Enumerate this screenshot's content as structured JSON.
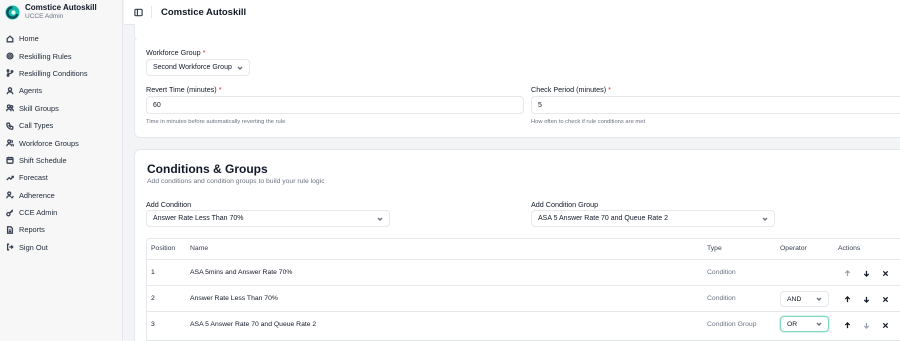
{
  "app": {
    "name": "Comstice Autoskill",
    "subtitle": "UCCE Admin"
  },
  "sidebar": {
    "items": [
      {
        "label": "Home",
        "icon": "home-icon"
      },
      {
        "label": "Reskilling Rules",
        "icon": "gear-icon"
      },
      {
        "label": "Reskilling Conditions",
        "icon": "branch-icon"
      },
      {
        "label": "Agents",
        "icon": "user-icon"
      },
      {
        "label": "Skill Groups",
        "icon": "users-icon"
      },
      {
        "label": "Call Types",
        "icon": "phone-icon"
      },
      {
        "label": "Workforce Groups",
        "icon": "user-group-icon"
      },
      {
        "label": "Shift Schedule",
        "icon": "calendar-icon"
      },
      {
        "label": "Forecast",
        "icon": "trend-icon"
      },
      {
        "label": "Adherence",
        "icon": "user-check-icon"
      },
      {
        "label": "CCE Admin",
        "icon": "key-icon"
      },
      {
        "label": "Reports",
        "icon": "file-icon"
      },
      {
        "label": "Sign Out",
        "icon": "logout-icon"
      }
    ]
  },
  "header": {
    "title": "Comstice Autoskill"
  },
  "form": {
    "workforce_group_label": "Workforce Group",
    "workforce_group_value": "Second Workforce Group",
    "revert_time_label": "Revert Time (minutes)",
    "revert_time_value": "60",
    "revert_time_help": "Time in minutes before automatically reverting the rule",
    "check_period_label": "Check Period (minutes)",
    "check_period_value": "5",
    "check_period_help": "How often to check if rule conditions are met",
    "required_mark": "*"
  },
  "conditions": {
    "title": "Conditions & Groups",
    "subtitle": "Add conditions and condition groups to build your rule logic",
    "add_condition_label": "Add Condition",
    "add_condition_value": "Answer Rate Less Than 70%",
    "add_group_label": "Add Condition Group",
    "add_group_value": "ASA 5 Answer Rate 70 and Queue Rate 2",
    "columns": [
      "Position",
      "Name",
      "Type",
      "Operator",
      "Actions"
    ],
    "rows": [
      {
        "position": "1",
        "name": "ASA 5mins and Answer Rate 70%",
        "type": "Condition",
        "operator": ""
      },
      {
        "position": "2",
        "name": "Answer Rate Less Than 70%",
        "type": "Condition",
        "operator": "AND"
      },
      {
        "position": "3",
        "name": "ASA 5 Answer Rate 70 and Queue Rate 2",
        "type": "Condition Group",
        "operator": "OR"
      }
    ]
  },
  "colors": {
    "accent": "#14b8a6",
    "required": "#dc2626",
    "focus_ring": "#7fd6c1"
  }
}
